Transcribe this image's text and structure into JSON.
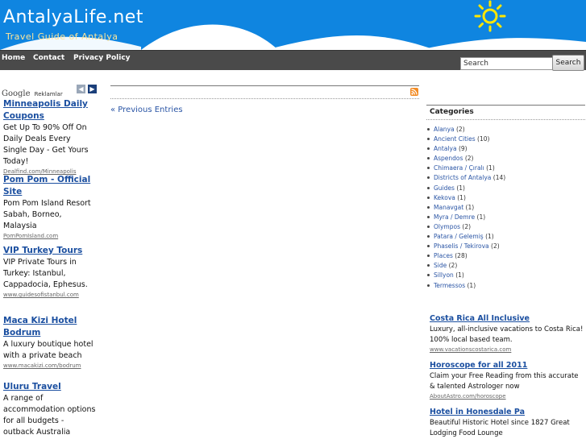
{
  "header": {
    "title": "AntalyaLife.net",
    "tagline": "Travel Guide of Antalya"
  },
  "nav": {
    "items": [
      "Home",
      "Contact",
      "Privacy Policy"
    ]
  },
  "search": {
    "value": "Search",
    "button_label": "Search"
  },
  "ads_left": {
    "google_label": "Google",
    "reklam_label": "Reklamlar",
    "items": [
      {
        "title": "Minneapolis Daily Coupons",
        "body": "Get Up To 90% Off On Daily Deals Every Single Day - Get Yours Today!",
        "url": "Dealfind.com/Minneapolis"
      },
      {
        "title": "Pom Pom - Official Site",
        "body": "Pom Pom Island Resort Sabah, Borneo, Malaysia",
        "url": "PomPomIsland.com"
      },
      {
        "title": "VIP Turkey Tours",
        "body": "VIP Private Tours in Turkey: Istanbul, Cappadocia, Ephesus.",
        "url": "www.guidesofistanbul.com"
      },
      {
        "title": "Maca Kizi Hotel Bodrum",
        "body": "A luxury boutique hotel with a private beach",
        "url": "www.macakizi.com/bodrum"
      },
      {
        "title": "Uluru Travel",
        "body": "A range of accommodation options for all budgets - outback Australia",
        "url": ""
      }
    ]
  },
  "main": {
    "prev_entries": "« Previous Entries"
  },
  "categories": {
    "title": "Categories",
    "items": [
      {
        "name": "Alanya",
        "count": "(2)"
      },
      {
        "name": "Ancient Cities",
        "count": "(10)"
      },
      {
        "name": "Antalya",
        "count": "(9)"
      },
      {
        "name": "Aspendos",
        "count": "(2)"
      },
      {
        "name": "Chimaera / Çıralı",
        "count": "(1)"
      },
      {
        "name": "Districts of Antalya",
        "count": "(14)"
      },
      {
        "name": "Guides",
        "count": "(1)"
      },
      {
        "name": "Kekova",
        "count": "(1)"
      },
      {
        "name": "Manavgat",
        "count": "(1)"
      },
      {
        "name": "Myra / Demre",
        "count": "(1)"
      },
      {
        "name": "Olympos",
        "count": "(2)"
      },
      {
        "name": "Patara / Gelemiş",
        "count": "(1)"
      },
      {
        "name": "Phaselis / Tekirova",
        "count": "(2)"
      },
      {
        "name": "Places",
        "count": "(28)"
      },
      {
        "name": "Side",
        "count": "(2)"
      },
      {
        "name": "Sillyon",
        "count": "(1)"
      },
      {
        "name": "Termessos",
        "count": "(1)"
      }
    ]
  },
  "ads_right": {
    "items": [
      {
        "title": "Costa Rica All Inclusive",
        "body": "Luxury, all-inclusive vacations to Costa Rica! 100% local based team.",
        "url": "www.vacationscostarica.com"
      },
      {
        "title": "Horoscope for all 2011",
        "body": "Claim your Free Reading from this accurate & talented Astrologer now",
        "url": "AboutAstro.com/horoscope"
      },
      {
        "title": "Hotel in Honesdale Pa",
        "body": "Beautiful Historic Hotel since 1827 Great Lodging Food Lounge",
        "url": ""
      }
    ]
  },
  "colors": {
    "header_blue": "#0f85e0",
    "nav_gray": "#4a4a4a",
    "link_blue": "#1b4fa0",
    "sun_yellow": "#ffe600"
  }
}
